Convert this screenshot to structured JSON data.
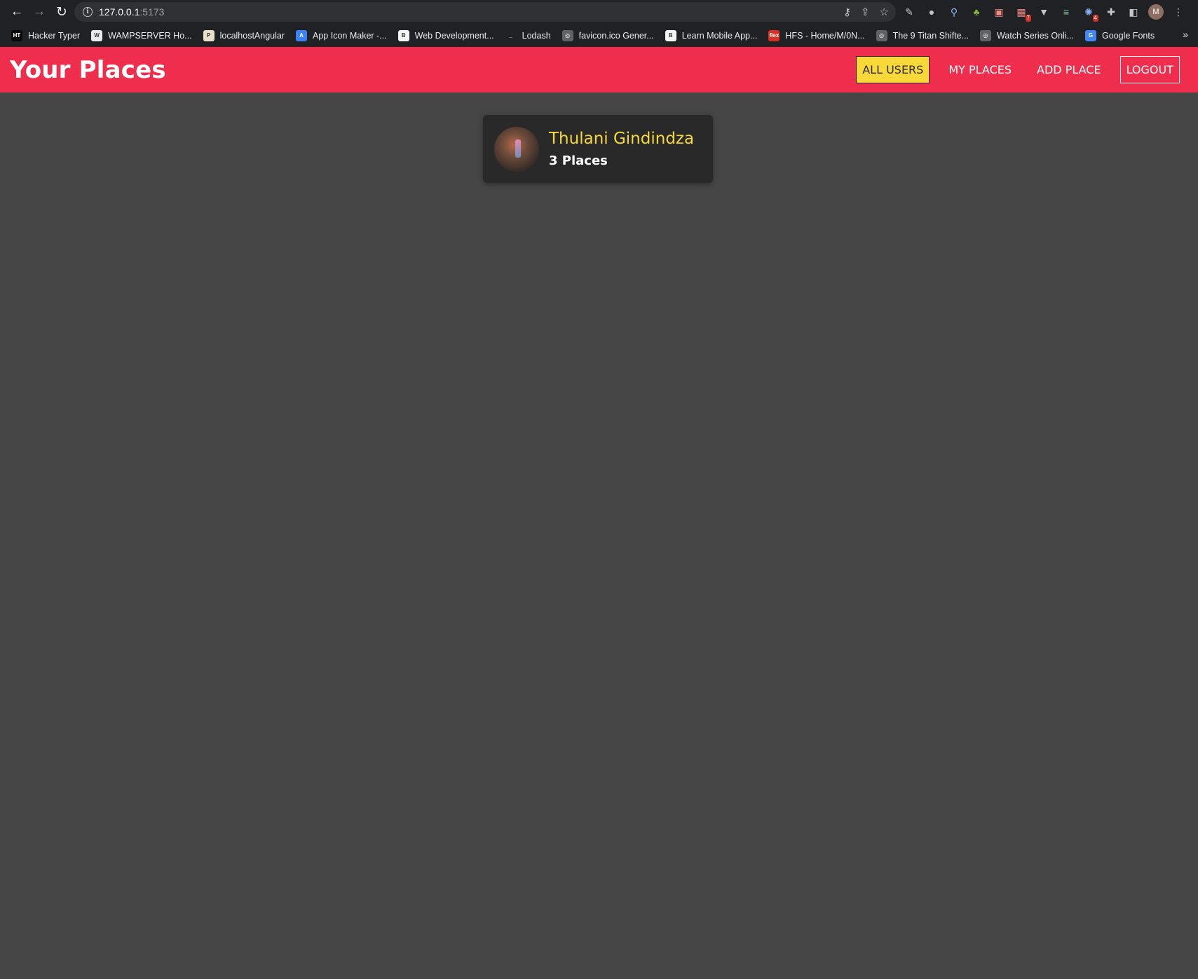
{
  "browser": {
    "url_host": "127.0.0.1",
    "url_port": ":5173",
    "profile_initial": "M",
    "extension_badges": [
      "7",
      "4"
    ],
    "bookmarks": [
      {
        "label": "Hacker Typer",
        "fav": "HT",
        "color": "#0a0a0a"
      },
      {
        "label": "WAMPSERVER Ho...",
        "fav": "W",
        "color": "#e8eaed"
      },
      {
        "label": "localhostAngular",
        "fav": "P",
        "color": "#e8e0c8"
      },
      {
        "label": "App Icon Maker -...",
        "fav": "A",
        "color": "#3b82f6"
      },
      {
        "label": "Web Development...",
        "fav": "B",
        "color": "#f5f5f5"
      },
      {
        "label": "Lodash",
        "fav": "_",
        "color": "#202124"
      },
      {
        "label": "favicon.ico Gener...",
        "fav": "◎",
        "color": "#5f6368"
      },
      {
        "label": "Learn Mobile App...",
        "fav": "B",
        "color": "#f5f5f5"
      },
      {
        "label": "HFS - Home/M/0N...",
        "fav": "flex",
        "color": "#d93025"
      },
      {
        "label": "The 9 Titan Shifte...",
        "fav": "◎",
        "color": "#5f6368"
      },
      {
        "label": "Watch Series Onli...",
        "fav": "◎",
        "color": "#5f6368"
      },
      {
        "label": "Google Fonts",
        "fav": "G",
        "color": "#4285f4"
      }
    ]
  },
  "header": {
    "title": "Your Places",
    "nav": {
      "all_users": "ALL USERS",
      "my_places": "MY PLACES",
      "add_place": "ADD PLACE",
      "logout": "LOGOUT"
    }
  },
  "users": [
    {
      "name": "Thulani Gindindza",
      "places": "3 Places"
    }
  ],
  "colors": {
    "header_bg": "#ef2d4d",
    "accent": "#f8d939",
    "page_bg": "#464646",
    "card_bg": "#292929"
  }
}
